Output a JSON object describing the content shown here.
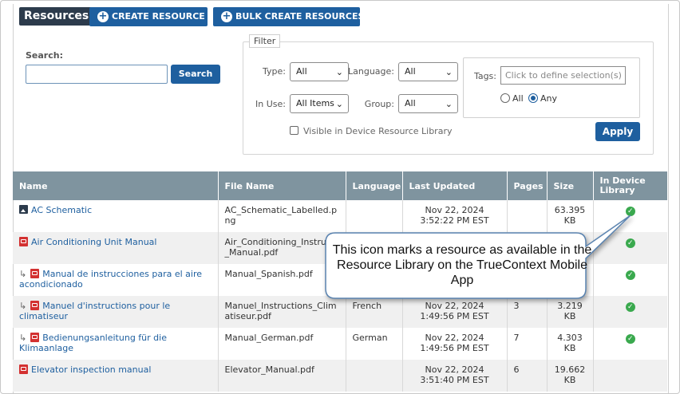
{
  "toolbar": {
    "resources_label": "Resources",
    "create_label": "CREATE RESOURCE",
    "bulk_label": "BULK CREATE RESOURCES"
  },
  "search": {
    "label": "Search:",
    "value": "",
    "button": "Search"
  },
  "filter": {
    "legend": "Filter",
    "type_label": "Type:",
    "type_value": "All",
    "language_label": "Language:",
    "language_value": "All",
    "in_use_label": "In Use:",
    "in_use_value": "All Items",
    "group_label": "Group:",
    "group_value": "All",
    "tags_label": "Tags:",
    "tags_placeholder": "Click to define selection(s)",
    "radio_all": "All",
    "radio_any": "Any",
    "visible_label": "Visible in Device Resource Library",
    "apply": "Apply"
  },
  "table": {
    "headers": [
      "Name",
      "File Name",
      "Language",
      "Last Updated",
      "Pages",
      "Size",
      "In Device Library"
    ],
    "rows": [
      {
        "icon": "image",
        "sub": false,
        "name": "AC Schematic",
        "file": "AC_Schematic_Labelled.png",
        "language": "",
        "updated": "Nov 22, 2024 3:52:22 PM EST",
        "pages": "",
        "size": "63.395 KB",
        "in_library": true
      },
      {
        "icon": "pdf",
        "sub": false,
        "name": "Air Conditioning Unit Manual",
        "file": "Air_Conditioning_Instructi_Manual.pdf",
        "language": "",
        "updated": "",
        "pages": "",
        "size": "",
        "in_library": true
      },
      {
        "icon": "pdf",
        "sub": true,
        "name": "Manual de instrucciones para el aire acondicionado",
        "file": "Manual_Spanish.pdf",
        "language": "",
        "updated": "",
        "pages": "",
        "size": "",
        "in_library": true
      },
      {
        "icon": "pdf",
        "sub": true,
        "name": "Manuel d'instructions pour le climatiseur",
        "file": "Manuel_Instructions_Climatiseur.pdf",
        "language": "French",
        "updated": "Nov 22, 2024 1:49:56 PM EST",
        "pages": "3",
        "size": "3.219 KB",
        "in_library": true
      },
      {
        "icon": "pdf",
        "sub": true,
        "name": "Bedienungsanleitung für die Klimaanlage",
        "file": "Manual_German.pdf",
        "language": "German",
        "updated": "Nov 22, 2024 1:49:56 PM EST",
        "pages": "7",
        "size": "4.303 KB",
        "in_library": true
      },
      {
        "icon": "pdf",
        "sub": false,
        "name": "Elevator inspection manual",
        "file": "Elevator_Manual.pdf",
        "language": "",
        "updated": "Nov 22, 2024 3:51:40 PM EST",
        "pages": "6",
        "size": "19.662 KB",
        "in_library": false
      }
    ]
  },
  "callout": {
    "text": "This icon marks a resource as available in the Resource Library on the TrueContext Mobile App"
  },
  "colors": {
    "primary": "#1e5f9f",
    "header_bg": "#7f949f",
    "label_bg": "#2c3b4c",
    "check": "#3aa94e",
    "pdf": "#d33131"
  }
}
